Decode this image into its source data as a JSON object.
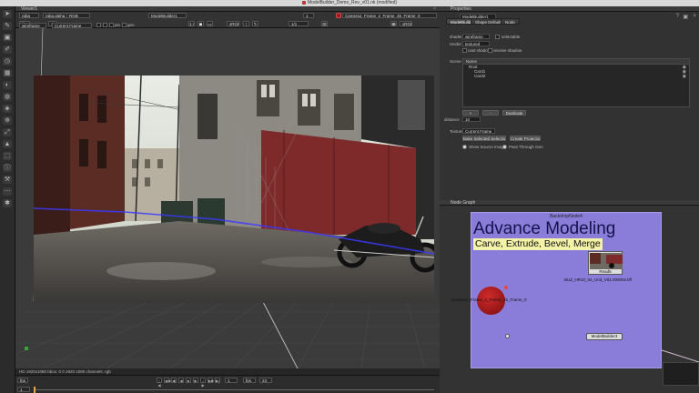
{
  "window": {
    "title": "ModelBuilder_Demo_Rev_v01.nk (modified)"
  },
  "colors": {
    "backdrop": "#8a7cd9",
    "sphere": "#b01a1a",
    "label_highlight": "#f3f2a8",
    "active_red": "#9a2020"
  },
  "toolbar": {
    "icons": [
      "pointer-icon",
      "paint-icon",
      "image-icon",
      "draw-icon",
      "time-icon",
      "channel-icon",
      "color-icon",
      "filter-icon",
      "keyer-icon",
      "merge-icon",
      "transform-icon",
      "3d-icon",
      "views-icon",
      "metadata-icon",
      "toolsets-icon",
      "other-icon",
      "furnace-icon"
    ]
  },
  "viewer": {
    "tab_label": "Viewer1",
    "channels": "rgba",
    "alpha": "rgba.alpha",
    "colorspace": "RGB",
    "node": "ModelBuilder1",
    "gain_label": "f/8",
    "gain": "1",
    "input_a": "Camera1_Frame_2_Frame_45_Frame_0",
    "frame": "1",
    "zoom": "1:1",
    "lut": "sRGB",
    "proxy_label": "1/1",
    "mode": "wireframe",
    "camera_mode": "Current Frame",
    "sel_label": "pin",
    "geo_label": "geo",
    "info": "HD 1920x1080  bbox: 0 0 1920 1080 channels: rgb",
    "timeline": {
      "fps_label": "fps",
      "fps": "24",
      "frame_current": "1",
      "frame_start": "1"
    }
  },
  "properties": {
    "tab_label": "Properties",
    "node_name": "ModelBuilder1",
    "tabs": [
      "ModelBuilder",
      "Shape Defaults",
      "Node"
    ],
    "shader_label": "shader",
    "shader_value": "wireframe",
    "selectable_label": "selectable",
    "render_label": "render",
    "render_value": "textured",
    "cast_shadow_label": "cast shadow",
    "receive_shadow_label": "receive shadow",
    "scene_label": "Scene",
    "scene_header": "Name",
    "scene_items": [
      "Root",
      "Card1",
      "Card2"
    ],
    "add_label": "+",
    "remove_label": "-",
    "duplicate_label": "Duplicate",
    "bake_label": "Bake",
    "texture_label": "Texture",
    "texture_value": "Current Frame",
    "bake_selection_label": "Bake Selected Selection",
    "create_projection_label": "Create Projection",
    "show_source_label": "Show Source Image",
    "pass_through_label": "Pass Through Geo",
    "distance_label": "distance",
    "distance_value": "10"
  },
  "node_graph": {
    "tab_label": "Node Graph",
    "backdrop_title": "BackdropNode4",
    "heading": "Advance Modeling",
    "subheading": "Carve, Extrude, Bevel, Merge",
    "read_node_name": "Read5",
    "read_file": "BUZ_HR10_04_Und_V01.000002.tiff",
    "camera_label": "Camera1_Frame_2_Frame_45_Frame_0",
    "modelbuilder_label": "ModelBuilder3"
  }
}
